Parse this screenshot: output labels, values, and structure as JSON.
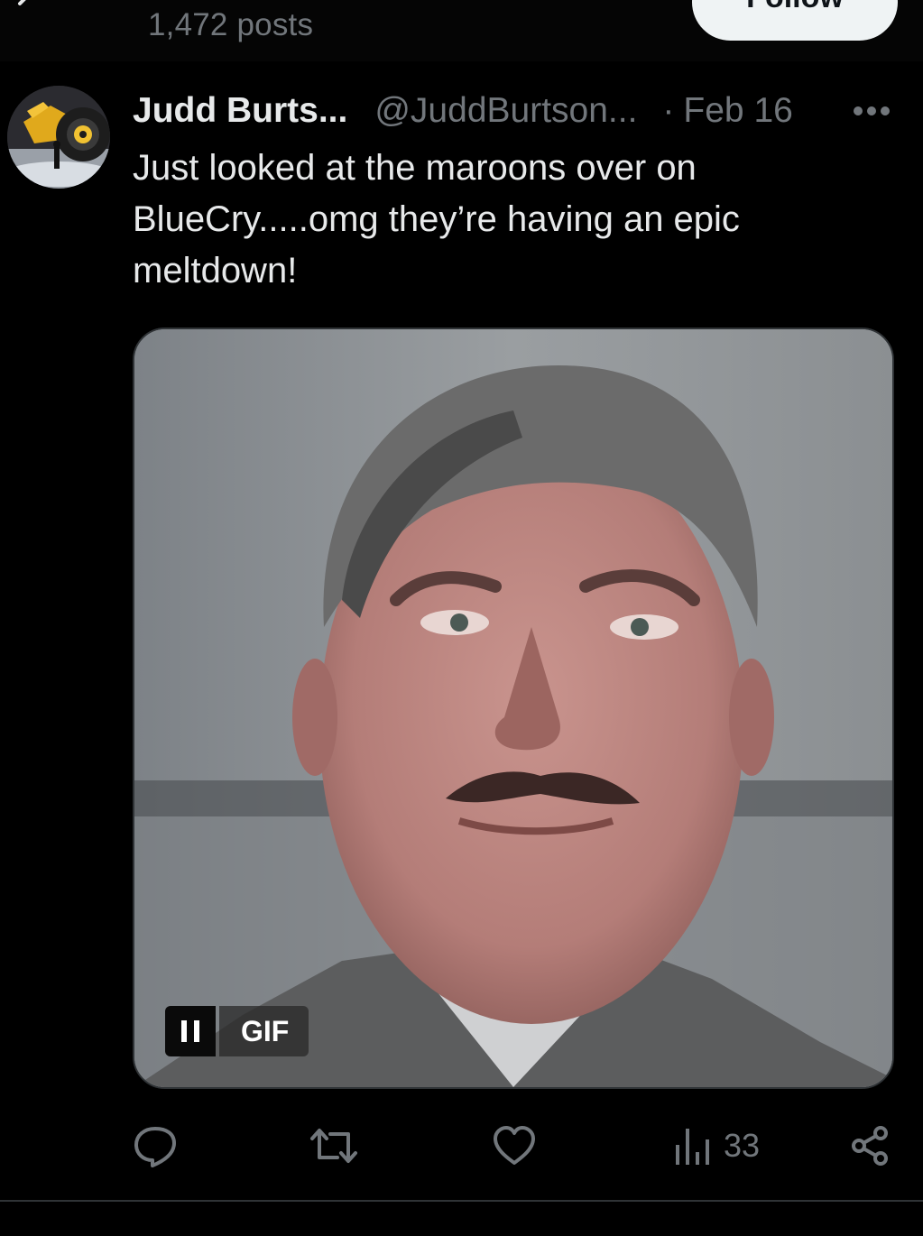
{
  "header": {
    "posts_count": "1,472 posts",
    "follow_label": "Follow"
  },
  "post": {
    "display_name": "Judd Burts...",
    "handle": "@JuddBurtson...",
    "separator": "·",
    "date": "Feb 16",
    "text": "Just looked at the maroons over on BlueCry.....omg they’re having an epic meltdown!",
    "media": {
      "badge": "GIF",
      "pause_icon": "pause-icon"
    },
    "actions": {
      "reply_icon": "reply-icon",
      "repost_icon": "repost-icon",
      "like_icon": "heart-icon",
      "views_icon": "views-icon",
      "views_count": "33",
      "share_icon": "share-icon"
    }
  },
  "colors": {
    "background": "#000000",
    "primary_text": "#e7e9ea",
    "secondary_text": "#71767b",
    "follow_bg": "#eff3f4",
    "border": "#2f3336"
  }
}
